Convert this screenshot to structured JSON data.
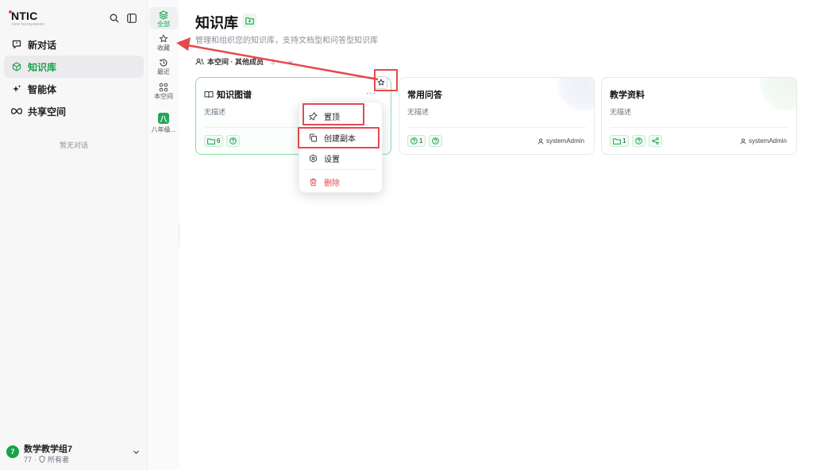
{
  "brand": {
    "name": "NTIC",
    "tagline": "Nantic Teaching Assistant"
  },
  "sidebar": {
    "items": [
      {
        "label": "新对话",
        "icon": "chat-icon"
      },
      {
        "label": "知识库",
        "icon": "cube-icon",
        "active": true
      },
      {
        "label": "智能体",
        "icon": "sparkle-icon"
      },
      {
        "label": "共享空间",
        "icon": "infinity-icon"
      }
    ],
    "empty_hint": "暂无对话",
    "user": {
      "avatar": "7",
      "name": "数学教学组7",
      "id": "77",
      "role": "所有者"
    }
  },
  "rail": {
    "items": [
      {
        "label": "全部",
        "icon": "layers-icon",
        "active": true
      },
      {
        "label": "收藏",
        "icon": "star-icon"
      },
      {
        "label": "最近",
        "icon": "history-icon"
      },
      {
        "label": "本空间",
        "icon": "space-icon"
      },
      {
        "label": "八年级...",
        "chip": "八"
      }
    ]
  },
  "main": {
    "title": "知识库",
    "subtitle": "管理和组织您的知识库，支持文档型和问答型知识库",
    "space_label": "本空间 · 其他成员",
    "space_count": "3",
    "cards": [
      {
        "title": "知识图谱",
        "desc": "无描述",
        "tags": [
          {
            "icon": "folder-icon",
            "count": "6"
          },
          {
            "icon": "help-icon",
            "count": ""
          }
        ],
        "owner": "",
        "more": "···"
      },
      {
        "title": "常用问答",
        "desc": "无描述",
        "tags": [
          {
            "icon": "help-icon",
            "count": "1"
          },
          {
            "icon": "help-icon",
            "count": ""
          }
        ],
        "owner": "systemAdmin"
      },
      {
        "title": "教学资料",
        "desc": "无描述",
        "tags": [
          {
            "icon": "folder-icon",
            "count": "1"
          },
          {
            "icon": "help-icon",
            "count": ""
          },
          {
            "icon": "share-icon",
            "count": ""
          }
        ],
        "owner": "systemAdmin"
      }
    ]
  },
  "menu": {
    "items": [
      {
        "label": "置顶",
        "icon": "pin-icon"
      },
      {
        "label": "创建副本",
        "icon": "copy-icon"
      },
      {
        "label": "设置",
        "icon": "gear-icon"
      },
      {
        "label": "删除",
        "icon": "trash-icon",
        "danger": true
      }
    ]
  },
  "colors": {
    "accent": "#16a34a",
    "annotation": "#e5484d",
    "danger": "#e5484d"
  }
}
